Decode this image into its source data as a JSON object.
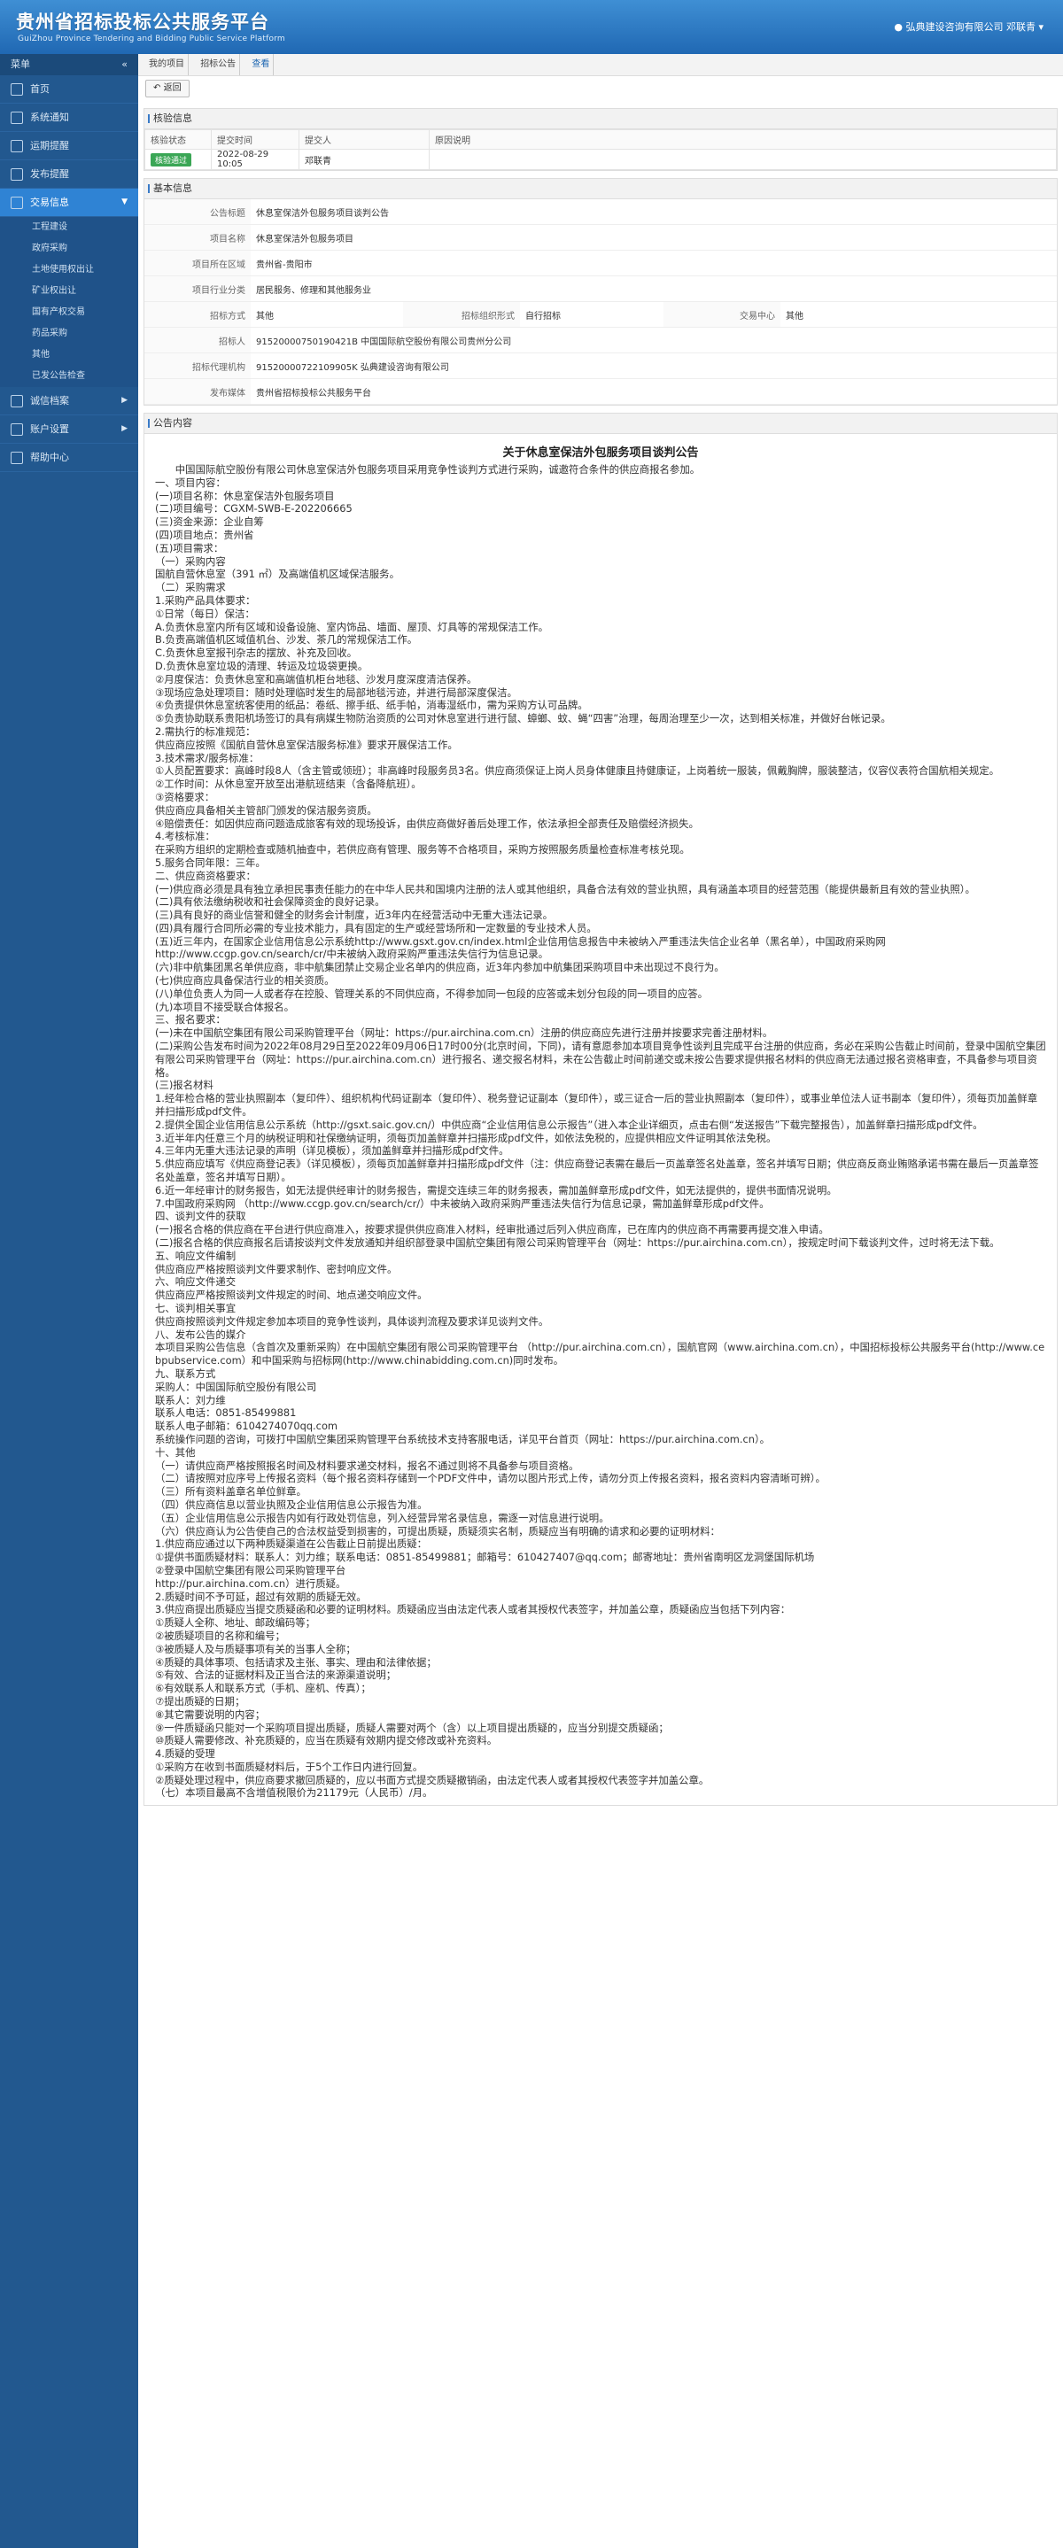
{
  "header": {
    "title_cn": "贵州省招标投标公共服务平台",
    "title_en": "GuiZhou Province Tendering and Bidding Public Service Platform",
    "user": "弘典建设咨询有限公司 邓联青"
  },
  "sidebar": {
    "head": "菜单",
    "items": [
      {
        "label": "首页",
        "icon": "home-icon"
      },
      {
        "label": "系统通知",
        "icon": "bell-icon"
      },
      {
        "label": "运期提醒",
        "icon": "clock-icon"
      },
      {
        "label": "发布提醒",
        "icon": "send-icon"
      },
      {
        "label": "交易信息",
        "icon": "list-icon",
        "active": true
      }
    ],
    "sub_items": [
      "工程建设",
      "政府采购",
      "土地使用权出让",
      "矿业权出让",
      "国有产权交易",
      "药品采购",
      "其他",
      "已发公告检查"
    ],
    "items_after": [
      {
        "label": "诚信档案",
        "icon": "folder-icon"
      },
      {
        "label": "账户设置",
        "icon": "gear-icon"
      },
      {
        "label": "帮助中心",
        "icon": "help-icon"
      }
    ]
  },
  "breadcrumb": [
    "我的项目",
    "招标公告",
    "查看"
  ],
  "toolbar": {
    "back_label": "返回"
  },
  "review": {
    "title": "核验信息",
    "headers": [
      "核验状态",
      "提交时间",
      "提交人",
      "原因说明"
    ],
    "row": {
      "status": "核验通过",
      "time": "2022-08-29 10:05",
      "submitter": "邓联青",
      "reason": ""
    }
  },
  "basic": {
    "title": "基本信息",
    "rows": {
      "notice_title_label": "公告标题",
      "notice_title": "休息室保洁外包服务项目谈判公告",
      "project_name_label": "项目名称",
      "project_name": "休息室保洁外包服务项目",
      "region_label": "项目所在区域",
      "region": "贵州省-贵阳市",
      "industry_label": "项目行业分类",
      "industry": "居民服务、修理和其他服务业",
      "method_label": "招标方式",
      "method": "其他",
      "org_form_label": "招标组织形式",
      "org_form": "自行招标",
      "center_label": "交易中心",
      "center": "其他",
      "tenderer_label": "招标人",
      "tenderer": "91520000750190421B 中国国际航空股份有限公司贵州分公司",
      "agency_label": "招标代理机构",
      "agency": "91520000722109905K 弘典建设咨询有限公司",
      "publisher_label": "发布媒体",
      "publisher": "贵州省招标投标公共服务平台"
    }
  },
  "announcement": {
    "panel_title": "公告内容",
    "title": "关于休息室保洁外包服务项目谈判公告",
    "lines": [
      "　　中国国际航空股份有限公司休息室保洁外包服务项目采用竞争性谈判方式进行采购，诚邀符合条件的供应商报名参加。",
      "一、项目内容：",
      "(一)项目名称：休息室保洁外包服务项目",
      "(二)项目编号：CGXM-SWB-E-202206665",
      "(三)资金来源：企业自筹",
      "(四)项目地点：贵州省",
      "(五)项目需求：",
      "（一）采购内容",
      "国航自营休息室（391 ㎡）及高端值机区域保洁服务。",
      "（二）采购需求",
      "1.采购产品具体要求：",
      "①日常（每日）保洁：",
      "A.负责休息室内所有区域和设备设施、室内饰品、墙面、屋顶、灯具等的常规保洁工作。",
      "B.负责高端值机区域值机台、沙发、茶几的常规保洁工作。",
      "C.负责休息室报刊杂志的摆放、补充及回收。",
      "D.负责休息室垃圾的清理、转运及垃圾袋更换。",
      "②月度保洁：负责休息室和高端值机柜台地毯、沙发月度深度清洁保养。",
      "③现场应急处理项目：随时处理临时发生的局部地毯污迹，并进行局部深度保洁。",
      "④负责提供休息室统客使用的纸品：卷纸、擦手纸、纸手帕，消毒湿纸巾，需为采购方认可品牌。",
      "⑤负责协助联系贵阳机场签订的具有病媒生物防治资质的公司对休息室进行进行鼠、蟑螂、蚊、蝇“四害”治理，每周治理至少一次，达到相关标准，并做好台帐记录。",
      "2.需执行的标准规范：",
      "供应商应按照《国航自营休息室保洁服务标准》要求开展保洁工作。",
      "3.技术需求/服务标准：",
      "①人员配置要求：高峰时段8人（含主管或领班）；非高峰时段服务员3名。供应商须保证上岗人员身体健康且持健康证，上岗着统一服装，佩戴胸牌，服装整洁，仪容仪表符合国航相关规定。",
      "②工作时间：从休息室开放至出港航班结束（含备降航班）。",
      "③资格要求：",
      "供应商应具备相关主管部门颁发的保洁服务资质。",
      "④赔偿责任：如因供应商问题造成旅客有效的现场投诉，由供应商做好善后处理工作，依法承担全部责任及赔偿经济损失。",
      "4.考核标准：",
      "在采购方组织的定期检查或随机抽查中，若供应商有管理、服务等不合格项目，采购方按照服务质量检查标准考核兑现。",
      "5.服务合同年限：三年。",
      "二、供应商资格要求：",
      "(一)供应商必须是具有独立承担民事责任能力的在中华人民共和国境内注册的法人或其他组织，具备合法有效的营业执照，具有涵盖本项目的经营范围（能提供最新且有效的营业执照）。",
      "(二)具有依法缴纳税收和社会保障资金的良好记录。",
      "(三)具有良好的商业信誉和健全的财务会计制度，近3年内在经营活动中无重大违法记录。",
      "(四)具有履行合同所必需的专业技术能力，具有固定的生产或经营场所和一定数量的专业技术人员。",
      "(五)近三年内，在国家企业信用信息公示系统http://www.gsxt.gov.cn/index.html企业信用信息报告中未被纳入严重违法失信企业名单（黑名单），中国政府采购网",
      "http://www.ccgp.gov.cn/search/cr/中未被纳入政府采购严重违法失信行为信息记录。",
      "(六)非中航集团黑名单供应商，非中航集团禁止交易企业名单内的供应商，近3年内参加中航集团采购项目中未出现过不良行为。",
      "(七)供应商应具备保洁行业的相关资质。",
      "(八)单位负责人为同一人或者存在控股、管理关系的不同供应商，不得参加同一包段的应答或未划分包段的同一项目的应答。",
      "(九)本项目不接受联合体报名。",
      "三、报名要求：",
      "(一)未在中国航空集团有限公司采购管理平台（网址：https://pur.airchina.com.cn）注册的供应商应先进行注册并按要求完善注册材料。",
      "(二)采购公告发布时间为2022年08月29日至2022年09月06日17时00分(北京时间，下同)，请有意愿参加本项目竞争性谈判且完成平台注册的供应商，务必在采购公告截止时间前，登录中国航空集团有限公司采购管理平台（网址：https://pur.airchina.com.cn）进行报名、递交报名材料，未在公告截止时间前递交或未按公告要求提供报名材料的供应商无法通过报名资格审查，不具备参与项目资格。",
      "(三)报名材料",
      "1.经年检合格的营业执照副本（复印件）、组织机构代码证副本（复印件）、税务登记证副本（复印件），或三证合一后的营业执照副本（复印件），或事业单位法人证书副本（复印件），须每页加盖鲜章并扫描形成pdf文件。",
      "2.提供全国企业信用信息公示系统（http://gsxt.saic.gov.cn/）中供应商“企业信用信息公示报告”（进入本企业详细页，点击右侧“发送报告”下载完整报告），加盖鲜章扫描形成pdf文件。",
      "3.近半年内任意三个月的纳税证明和社保缴纳证明，须每页加盖鲜章并扫描形成pdf文件，如依法免税的，应提供相应文件证明其依法免税。",
      "4.三年内无重大违法记录的声明（详见模板），须加盖鲜章并扫描形成pdf文件。",
      "5.供应商应填写《供应商登记表》（详见模板），须每页加盖鲜章并扫描形成pdf文件（注：供应商登记表需在最后一页盖章签名处盖章，签名并填写日期；供应商反商业贿赂承诺书需在最后一页盖章签名处盖章，签名并填写日期）。",
      "6.近一年经审计的财务报告，如无法提供经审计的财务报告，需提交连续三年的财务报表，需加盖鲜章形成pdf文件，如无法提供的，提供书面情况说明。",
      "7.中国政府采购网 （http://www.ccgp.gov.cn/search/cr/）中未被纳入政府采购严重违法失信行为信息记录，需加盖鲜章形成pdf文件。",
      "四、谈判文件的获取",
      "(一)报名合格的供应商在平台进行供应商准入，按要求提供供应商准入材料，经审批通过后列入供应商库，已在库内的供应商不再需要再提交准入申请。",
      "(二)报名合格的供应商报名后请按谈判文件发放通知并组织部登录中国航空集团有限公司采购管理平台（网址：https://pur.airchina.com.cn），按规定时间下载谈判文件，过时将无法下载。",
      "五、响应文件编制",
      "供应商应严格按照谈判文件要求制作、密封响应文件。",
      "六、响应文件递交",
      "供应商应严格按照谈判文件规定的时间、地点递交响应文件。",
      "七、谈判相关事宜",
      "供应商按照谈判文件规定参加本项目的竞争性谈判，具体谈判流程及要求详见谈判文件。",
      "八、发布公告的媒介",
      "本项目采购公告信息（含首次及重新采购）在中国航空集团有限公司采购管理平台 （http://pur.airchina.com.cn），国航官网（www.airchina.com.cn），中国招标投标公共服务平台(http://www.cebpubservice.com）和中国采购与招标网(http://www.chinabidding.com.cn)同时发布。",
      "九、联系方式",
      "采购人：中国国际航空股份有限公司",
      "联系人：刘力维",
      "联系人电话：0851-85499881",
      "联系人电子邮箱：6104274070qq.com",
      "系统操作问题的咨询，可拨打中国航空集团采购管理平台系统技术支持客服电话，详见平台首页（网址：https://pur.airchina.com.cn）。",
      "十、其他",
      "（一）请供应商严格按照报名时间及材料要求递交材料，报名不通过则将不具备参与项目资格。",
      "（二）请按照对应序号上传报名资料（每个报名资料存储到一个PDF文件中，请勿以图片形式上传，请勿分页上传报名资料，报名资料内容清晰可辨）。",
      "（三）所有资料盖章名单位鲜章。",
      "（四）供应商信息以营业执照及企业信用信息公示报告为准。",
      "（五）企业信用信息公示报告内如有行政处罚信息，列入经营异常名录信息，需逐一对信息进行说明。",
      "（六）供应商认为公告使自己的合法权益受到损害的，可提出质疑，质疑须实名制，质疑应当有明确的请求和必要的证明材料：",
      "1.供应商应通过以下两种质疑渠道在公告截止日前提出质疑：",
      "①提供书面质疑材料：联系人：刘力维；联系电话：0851-85499881；邮箱号：610427407@qq.com；邮寄地址：贵州省南明区龙洞堡国际机场",
      "②登录中国航空集团有限公司采购管理平台",
      "http://pur.airchina.com.cn）进行质疑。",
      "2.质疑时间不予可延，超过有效期的质疑无效。",
      "3.供应商提出质疑应当提交质疑函和必要的证明材料。质疑函应当由法定代表人或者其授权代表签字，并加盖公章，质疑函应当包括下列内容：",
      "①质疑人全称、地址、邮政编码等；",
      "②被质疑项目的名称和编号；",
      "③被质疑人及与质疑事项有关的当事人全称；",
      "④质疑的具体事项、包括请求及主张、事实、理由和法律依据；",
      "⑤有效、合法的证据材料及正当合法的来源渠道说明；",
      "⑥有效联系人和联系方式（手机、座机、传真）；",
      "⑦提出质疑的日期；",
      "⑧其它需要说明的内容；",
      "⑨一件质疑函只能对一个采购项目提出质疑，质疑人需要对两个（含）以上项目提出质疑的，应当分别提交质疑函；",
      "⑩质疑人需要修改、补充质疑的，应当在质疑有效期内提交修改或补充资料。",
      "4.质疑的受理",
      "①采购方在收到书面质疑材料后，于5个工作日内进行回复。",
      "②质疑处理过程中，供应商要求撤回质疑的，应以书面方式提交质疑撤销函，由法定代表人或者其授权代表签字并加盖公章。",
      "（七）本项目最高不含增值税限价为21179元（人民币）/月。"
    ]
  }
}
